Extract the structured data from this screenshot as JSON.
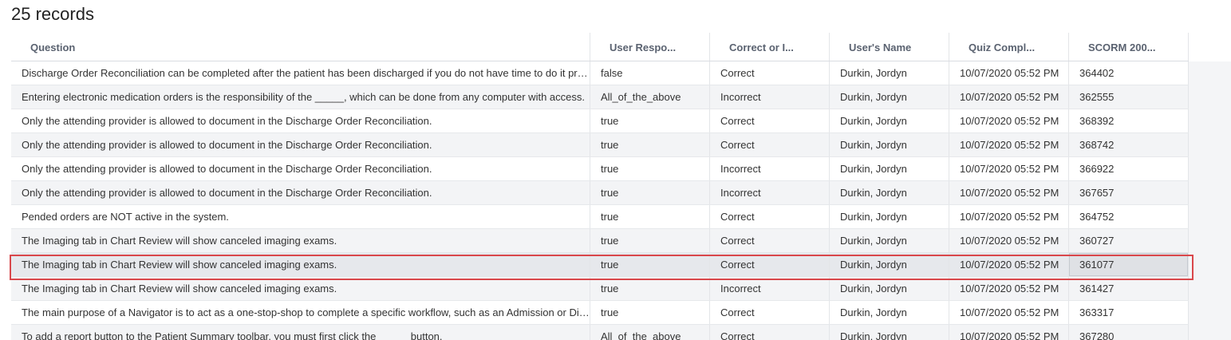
{
  "title": "25 records",
  "columns": [
    "Question",
    "User Respo...",
    "Correct or I...",
    "User's Name",
    "Quiz Compl...",
    "SCORM 200..."
  ],
  "rows": [
    [
      "Discharge Order Reconciliation can be completed after the patient has been discharged if you do not have time to do it prior to discharge.",
      "false",
      "Correct",
      "Durkin, Jordyn",
      "10/07/2020 05:52 PM",
      "364402"
    ],
    [
      "Entering electronic medication orders is the responsibility of the _____, which can be done from any computer with access.",
      "All_of_the_above",
      "Incorrect",
      "Durkin, Jordyn",
      "10/07/2020 05:52 PM",
      "362555"
    ],
    [
      "Only the attending provider is allowed to document in the Discharge Order Reconciliation.",
      "true",
      "Correct",
      "Durkin, Jordyn",
      "10/07/2020 05:52 PM",
      "368392"
    ],
    [
      "Only the attending provider is allowed to document in the Discharge Order Reconciliation.",
      "true",
      "Correct",
      "Durkin, Jordyn",
      "10/07/2020 05:52 PM",
      "368742"
    ],
    [
      "Only the attending provider is allowed to document in the Discharge Order Reconciliation.",
      "true",
      "Incorrect",
      "Durkin, Jordyn",
      "10/07/2020 05:52 PM",
      "366922"
    ],
    [
      "Only the attending provider is allowed to document in the Discharge Order Reconciliation.",
      "true",
      "Incorrect",
      "Durkin, Jordyn",
      "10/07/2020 05:52 PM",
      "367657"
    ],
    [
      "Pended orders are NOT active in the system.",
      "true",
      "Correct",
      "Durkin, Jordyn",
      "10/07/2020 05:52 PM",
      "364752"
    ],
    [
      "The Imaging tab in Chart Review will show canceled imaging exams.",
      "true",
      "Correct",
      "Durkin, Jordyn",
      "10/07/2020 05:52 PM",
      "360727"
    ],
    [
      "The Imaging tab in Chart Review will show canceled imaging exams.",
      "true",
      "Correct",
      "Durkin, Jordyn",
      "10/07/2020 05:52 PM",
      "361077"
    ],
    [
      "The Imaging tab in Chart Review will show canceled imaging exams.",
      "true",
      "Incorrect",
      "Durkin, Jordyn",
      "10/07/2020 05:52 PM",
      "361427"
    ],
    [
      "The main purpose of a Navigator is to act as a one-stop-shop to complete a specific workflow, such as an Admission or Discharge.",
      "true",
      "Correct",
      "Durkin, Jordyn",
      "10/07/2020 05:52 PM",
      "363317"
    ],
    [
      "To add a report button to the Patient Summary toolbar, you must first click the _____ button.",
      "All_of_the_above",
      "Correct",
      "Durkin, Jordyn",
      "10/07/2020 05:52 PM",
      "367280"
    ]
  ],
  "selected_row_index": 8,
  "highlight_color": "#d9474b"
}
